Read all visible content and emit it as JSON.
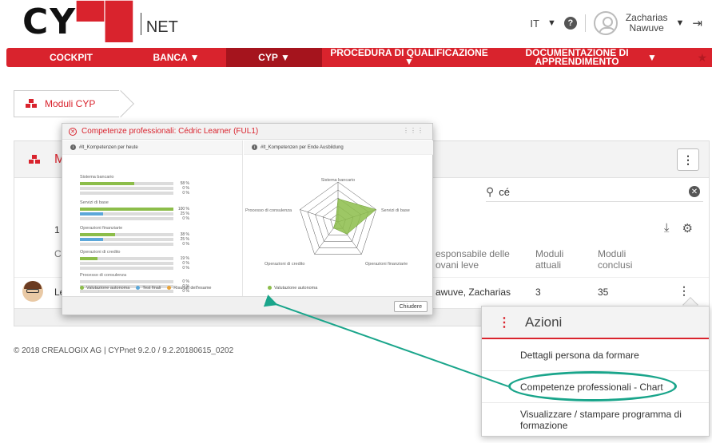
{
  "header": {
    "logo_text": "CY",
    "logo_net": "NET",
    "language": "IT",
    "help_label": "?",
    "user_first": "Zacharias",
    "user_last": "Nawuve"
  },
  "nav": {
    "items": [
      {
        "label": "COCKPIT"
      },
      {
        "label": "BANCA ▼"
      },
      {
        "label": "CYP ▼"
      },
      {
        "label": "PROCEDURA DI QUALIFICAZIONE ▼"
      },
      {
        "label": "DOCUMENTAZIONE DI APPRENDIMENTO"
      },
      {
        "label": "▼"
      }
    ]
  },
  "breadcrumb": {
    "label": "Moduli CYP"
  },
  "panel": {
    "title_fragment": "M",
    "search_value": "cé",
    "count": "1",
    "columns": {
      "c": "C",
      "responsible": "esponsabile delle\novani leve",
      "current": "Moduli\nattuali",
      "completed": "Moduli\nconclusi"
    },
    "row": {
      "name_fragment": "Le",
      "responsible": "awuve, Zacharias",
      "current": "3",
      "completed": "35"
    }
  },
  "footer": {
    "text": "© 2018 CREALOGIX AG  |  CYPnet 9.2.0 / 9.2.20180615_0202"
  },
  "modal": {
    "title": "Competenze professionali: Cédric Learner (FUL1)",
    "left_pane_title": "#lt_Kompetenzen per heute",
    "right_pane_title": "#lt_Kompetenzen per Ende Ausbildung",
    "competences": [
      {
        "name": "Sistema bancario",
        "p1": "58 %",
        "p2": "0 %",
        "p3": "0 %"
      },
      {
        "name": "Servizi di base",
        "p1": "100 %",
        "p2": "25 %",
        "p3": "0 %"
      },
      {
        "name": "Operazioni finanziarie",
        "p1": "38 %",
        "p2": "25 %",
        "p3": "0 %"
      },
      {
        "name": "Operazioni di credito",
        "p1": "19 %",
        "p2": "0 %",
        "p3": "0 %"
      },
      {
        "name": "Processo di consulenza",
        "p1": "0 %",
        "p2": "0 %",
        "p3": "0 %"
      }
    ],
    "legend": {
      "autonomous": "Valutazione autonoma",
      "final_test": "Test finali",
      "exam": "Risultati dell'esame"
    },
    "radar_labels": {
      "top": "Sistema bancario",
      "right": "Servizi di base",
      "bottom_right": "Operazioni finanziarie",
      "bottom_left": "Operazioni di credito",
      "left": "Processo di consulenza"
    },
    "close_label": "Chiudere"
  },
  "menu": {
    "title": "Azioni",
    "items": [
      {
        "label": "Dettagli persona da formare"
      },
      {
        "label": "Competenze professionali - Chart"
      },
      {
        "label": "Visualizzare / stampare programma di formazione"
      }
    ]
  },
  "colors": {
    "brand_red": "#d9232d",
    "nav_active": "#a5141d",
    "bar_green": "#8cbd4a",
    "bar_blue": "#5ba7d9",
    "annotation_teal": "#1aa58b"
  }
}
